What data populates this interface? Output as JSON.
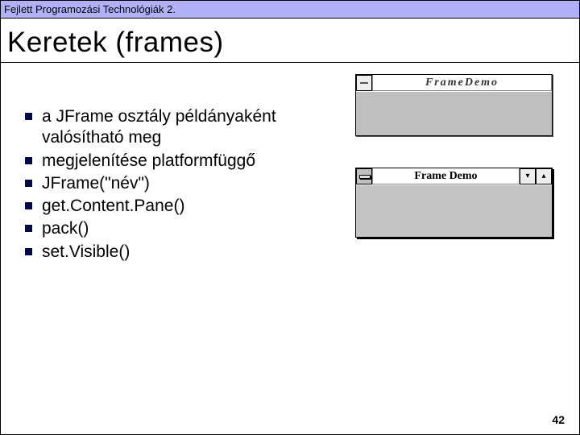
{
  "header": {
    "course": "Fejlett Programozási Technológiák 2."
  },
  "title": "Keretek (frames)",
  "bullets": [
    "a JFrame osztály példányaként valósítható meg",
    "megjelenítése platformfüggő",
    "JFrame(\"név\")",
    "get.Content.Pane()",
    "pack()",
    "set.Visible()"
  ],
  "figures": {
    "motif": {
      "title": "FrameDemo"
    },
    "win9x": {
      "title": "Frame Demo"
    }
  },
  "page_number": "42"
}
